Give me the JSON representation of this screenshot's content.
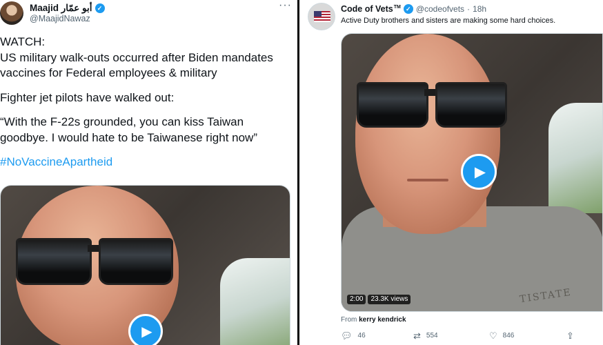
{
  "left_tweet": {
    "display_name": "Maajid أبو عمّار",
    "handle": "@MaajidNawaz",
    "more_icon": "more-icon",
    "paragraphs": [
      "WATCH:\nUS military walk-outs occurred after Biden mandates vaccines for Federal employees & military",
      "Fighter jet pilots have walked out:",
      "“With the F-22s grounded, you can kiss Taiwan goodbye. I would hate to be Taiwanese right now”"
    ],
    "hashtag": "#NoVaccineApartheid"
  },
  "right_tweet": {
    "display_name": "Code of Vets",
    "trademark": "TM",
    "handle": "@codeofvets",
    "separator": "·",
    "time": "18h",
    "text": "Active Duty brothers and sisters are making some hard choices.",
    "video": {
      "duration": "2:00",
      "views": "23.3K views",
      "shirt_print": "TISTATE"
    },
    "from_prefix": "From",
    "from_name": "kerry kendrick",
    "actions": {
      "replies": "46",
      "retweets": "554",
      "likes": "846"
    }
  },
  "colors": {
    "accent": "#1d9bf0",
    "text": "#0f1419",
    "muted": "#536471",
    "divider": "#000000"
  }
}
